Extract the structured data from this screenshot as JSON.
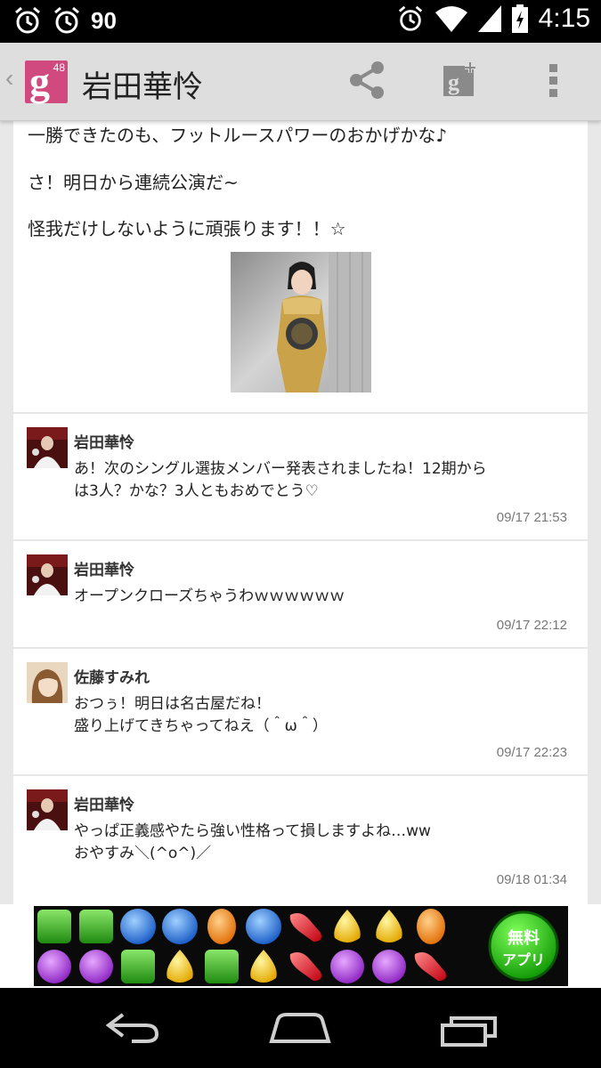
{
  "status_bar": {
    "battery_level": "90",
    "time": "4:15",
    "icons": [
      "alarm-icon",
      "alarm-icon",
      "alarm-icon",
      "wifi-icon",
      "signal-icon",
      "battery-charging-icon"
    ]
  },
  "action_bar": {
    "app_logo_badge": "48",
    "title": "岩田華怜",
    "icons": [
      "share-icon",
      "google-plus-icon",
      "overflow-menu-icon"
    ]
  },
  "post": {
    "lines": [
      "一勝できたのも、フットルースパワーのおかげかな♪",
      "さ！明日から連続公演だ~",
      "怪我だけしないように頑張ります！！☆"
    ]
  },
  "comments": [
    {
      "author": "岩田華怜",
      "lines": [
        "あ！次のシングル選抜メンバー発表されましたね！12期から",
        "は3人？かな？3人ともおめでとう♡"
      ],
      "timestamp": "09/17 21:53"
    },
    {
      "author": "岩田華怜",
      "lines": [
        "オープンクローズちゃうわｗｗｗｗｗｗ"
      ],
      "timestamp": "09/17 22:12"
    },
    {
      "author": "佐藤すみれ",
      "lines": [
        "おつぅ！明日は名古屋だね！",
        "盛り上げてきちゃってねえ（＾ω＾）"
      ],
      "timestamp": "09/17 22:23"
    },
    {
      "author": "岩田華怜",
      "lines": [
        "やっぱ正義感やたら強い性格って損しますよね…ww",
        "おやすみ＼(^o^)／"
      ],
      "timestamp": "09/18 01:34"
    }
  ],
  "ad": {
    "badge_line1": "無料",
    "badge_line2": "アプリ"
  },
  "nav_bar": {
    "icons": [
      "back-icon",
      "home-icon",
      "recent-apps-icon"
    ]
  },
  "colors": {
    "logo": "#d04a7f",
    "action_bar": "#dedede",
    "background": "#e8e8e8"
  }
}
